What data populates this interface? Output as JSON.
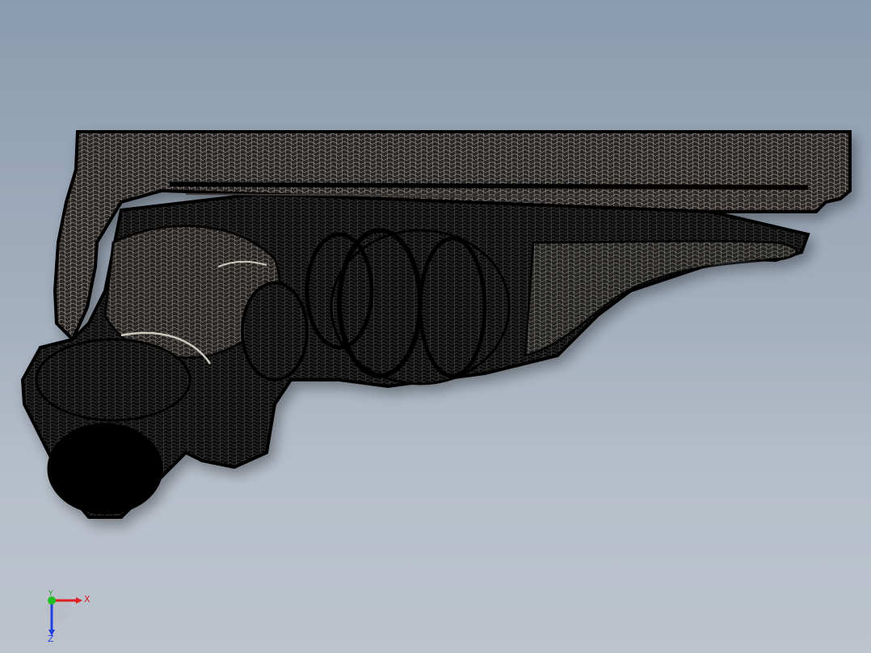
{
  "viewport": {
    "background_top": "#8a9cb0",
    "background_bottom": "#bcc3cd",
    "model_fill": "#0b0b0b",
    "mesh_highlight": "#b8b3aa"
  },
  "triad": {
    "x_label": "X",
    "y_label": "Y",
    "z_label": "Z",
    "x_color": "#e02020",
    "y_color": "#20c020",
    "z_color": "#2040e0"
  }
}
